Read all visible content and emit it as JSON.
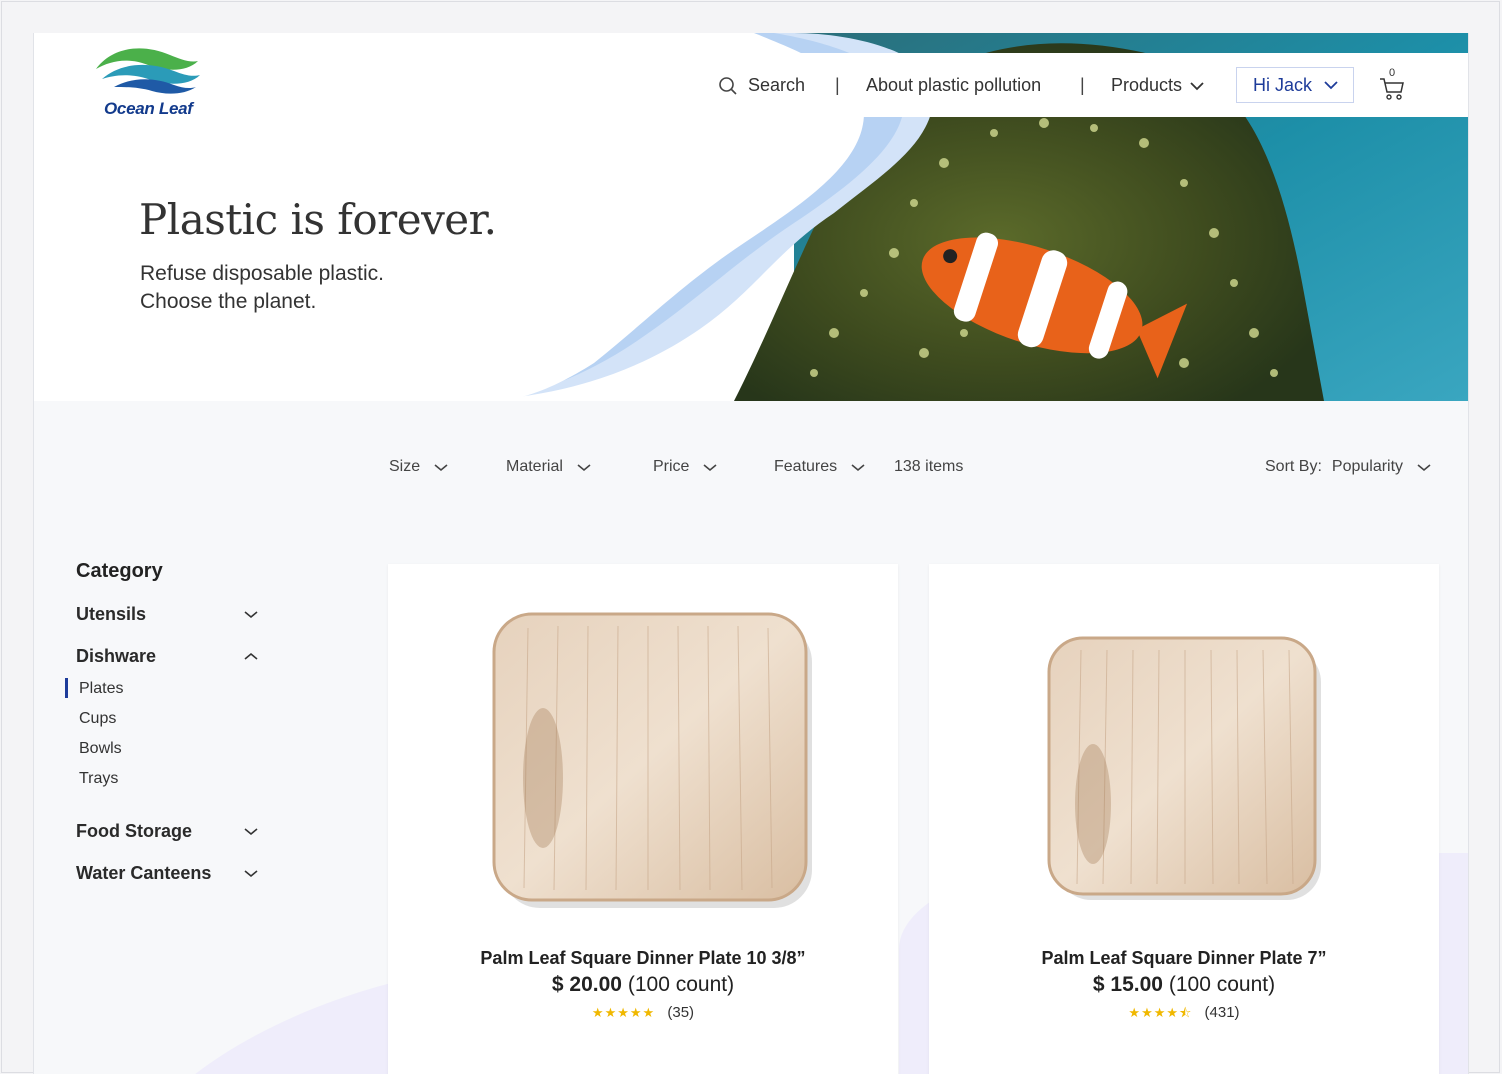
{
  "brand": {
    "name": "Ocean Leaf"
  },
  "nav": {
    "search_label": "Search",
    "sep": "|",
    "about_label": "About plastic pollution",
    "products_label": "Products",
    "user_label": "Hi Jack",
    "cart_count": "0"
  },
  "hero": {
    "title": "Plastic is forever.",
    "subtitle_line1": "Refuse disposable plastic.",
    "subtitle_line2": "Choose the planet."
  },
  "filters": {
    "size": "Size",
    "material": "Material",
    "price": "Price",
    "features": "Features",
    "item_count": "138 items",
    "sort_label": "Sort By:",
    "sort_value": "Popularity"
  },
  "sidebar": {
    "title": "Category",
    "categories": [
      {
        "label": "Utensils",
        "expanded": false
      },
      {
        "label": "Dishware",
        "expanded": true,
        "items": [
          {
            "label": "Plates",
            "active": true
          },
          {
            "label": "Cups",
            "active": false
          },
          {
            "label": "Bowls",
            "active": false
          },
          {
            "label": "Trays",
            "active": false
          }
        ]
      },
      {
        "label": "Food Storage",
        "expanded": false
      },
      {
        "label": "Water Canteens",
        "expanded": false
      }
    ]
  },
  "products": [
    {
      "name": "Palm Leaf Square Dinner Plate  10 3/8”",
      "price": "$ 20.00",
      "count": "(100 count)",
      "stars": "★★★★★",
      "rating": 5,
      "reviews": "(35)"
    },
    {
      "name": "Palm Leaf Square Dinner Plate  7”",
      "price": "$ 15.00",
      "count": "(100 count)",
      "stars": "★★★★⯪",
      "rating": 4.5,
      "reviews": "(431)"
    }
  ],
  "colors": {
    "accent": "#1e3c9a",
    "star": "#f0b800",
    "background": "#f7f8fa"
  },
  "icons": [
    "search-icon",
    "chevron-down-icon",
    "chevron-up-icon",
    "cart-icon",
    "logo-wave-icon"
  ]
}
